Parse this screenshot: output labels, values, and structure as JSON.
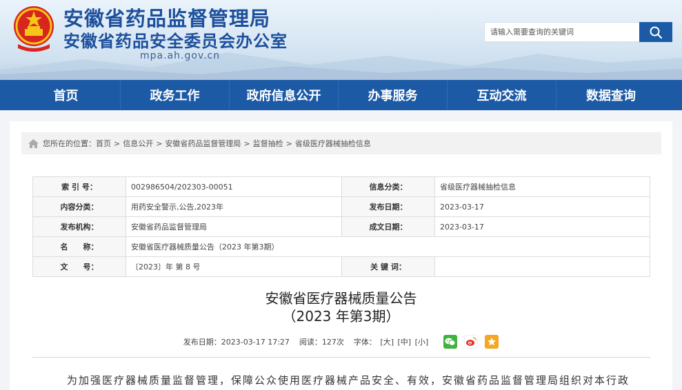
{
  "header": {
    "title_main": "安徽省药品监督管理局",
    "title_sub": "安徽省药品安全委员会办公室",
    "domain": "mpa.ah.gov.cn",
    "search_placeholder": "请输入需要查询的关键词"
  },
  "nav": [
    "首页",
    "政务工作",
    "政府信息公开",
    "办事服务",
    "互动交流",
    "数据查询"
  ],
  "breadcrumb": {
    "prefix": "您所在的位置：",
    "items": [
      "首页",
      "信息公开",
      "安徽省药品监督管理局",
      "监督抽检",
      "省级医疗器械抽检信息"
    ],
    "separator": ">"
  },
  "meta": {
    "index_label": "索 引 号：",
    "index_value": "002986504/202303-00051",
    "category_label": "信息分类：",
    "category_value": "省级医疗器械抽检信息",
    "content_label": "内容分类：",
    "content_value": "用药安全警示,公告,2023年",
    "publish_date_label": "发布日期：",
    "publish_date_value": "2023-03-17",
    "org_label": "发布机构：",
    "org_value": "安徽省药品监督管理局",
    "created_date_label": "成文日期：",
    "created_date_value": "2023-03-17",
    "name_label": "名　　称：",
    "name_value": "安徽省医疗器械质量公告（2023 年第3期）",
    "docno_label": "文　　号：",
    "docno_value": "〔2023〕年 第 8 号",
    "keywords_label": "关 键 词：",
    "keywords_value": ""
  },
  "article": {
    "title_line1": "安徽省医疗器械质量公告",
    "title_line2": "（2023 年第3期）",
    "publish_info": "发布日期：2023-03-17 17:27",
    "views": "阅读：127次",
    "font_label": "字体：",
    "font_large": "[大]",
    "font_medium": "[中]",
    "font_small": "[小]",
    "share_icons": [
      "wechat-icon",
      "weibo-icon",
      "favorite-icon"
    ],
    "paragraph": "为加强医疗器械质量监督管理，保障公众使用医疗器械产品安全、有效，安徽省药品监督管理局组织对本行政"
  },
  "colors": {
    "primary": "#1c5aa6",
    "title": "#1d4f9c",
    "wechat": "#3fb33f",
    "weibo": "#e6332a",
    "favorite": "#f5a623"
  }
}
